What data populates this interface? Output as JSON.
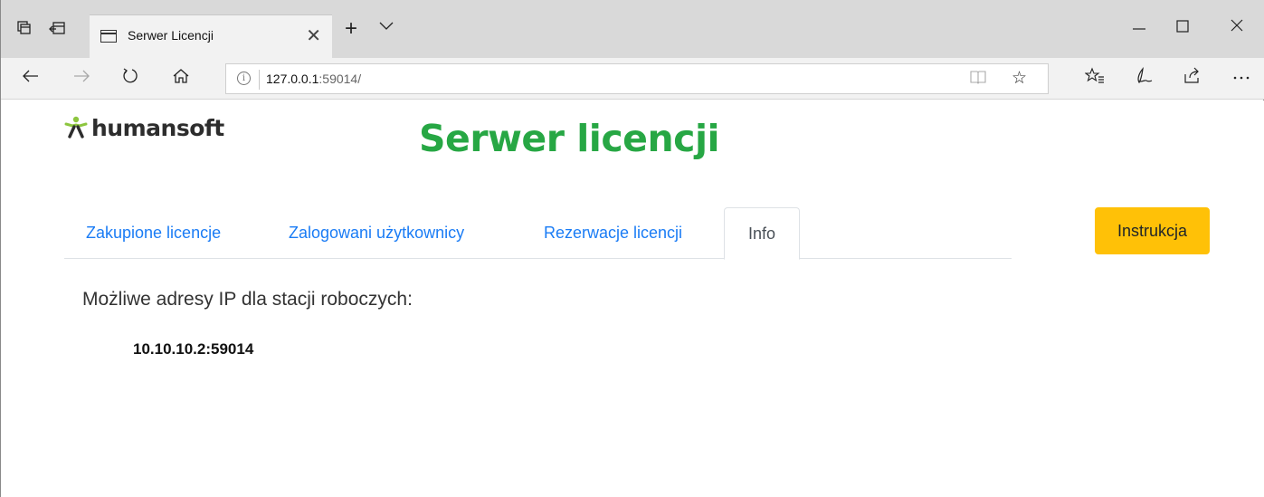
{
  "browser": {
    "tab_title": "Serwer Licencji",
    "url_host": "127.0.0.1",
    "url_port_path": ":59014/"
  },
  "page": {
    "logo_text": "humansoft",
    "title": "Serwer licencji",
    "tabs": [
      {
        "label": "Zakupione licencje",
        "active": false
      },
      {
        "label": "Zalogowani użytkownicy",
        "active": false
      },
      {
        "label": "Rezerwacje licencji",
        "active": false
      },
      {
        "label": "Info",
        "active": true
      }
    ],
    "instructions_button": "Instrukcja",
    "ip_heading": "Możliwe adresy IP dla stacji roboczych:",
    "ip_addresses": [
      "10.10.10.2:59014"
    ]
  },
  "colors": {
    "title_green": "#27a744",
    "link_blue": "#1a7cf5",
    "button_yellow": "#ffc107",
    "logo_green": "#8dc63f"
  },
  "icons": {
    "titlebar": [
      "tab-preview-icon",
      "set-aside-tabs-icon"
    ],
    "nav": [
      "back-icon",
      "forward-icon",
      "refresh-icon",
      "home-icon"
    ],
    "toolbar": [
      "favorites-hub-icon",
      "add-notes-icon",
      "share-icon",
      "more-icon"
    ]
  }
}
